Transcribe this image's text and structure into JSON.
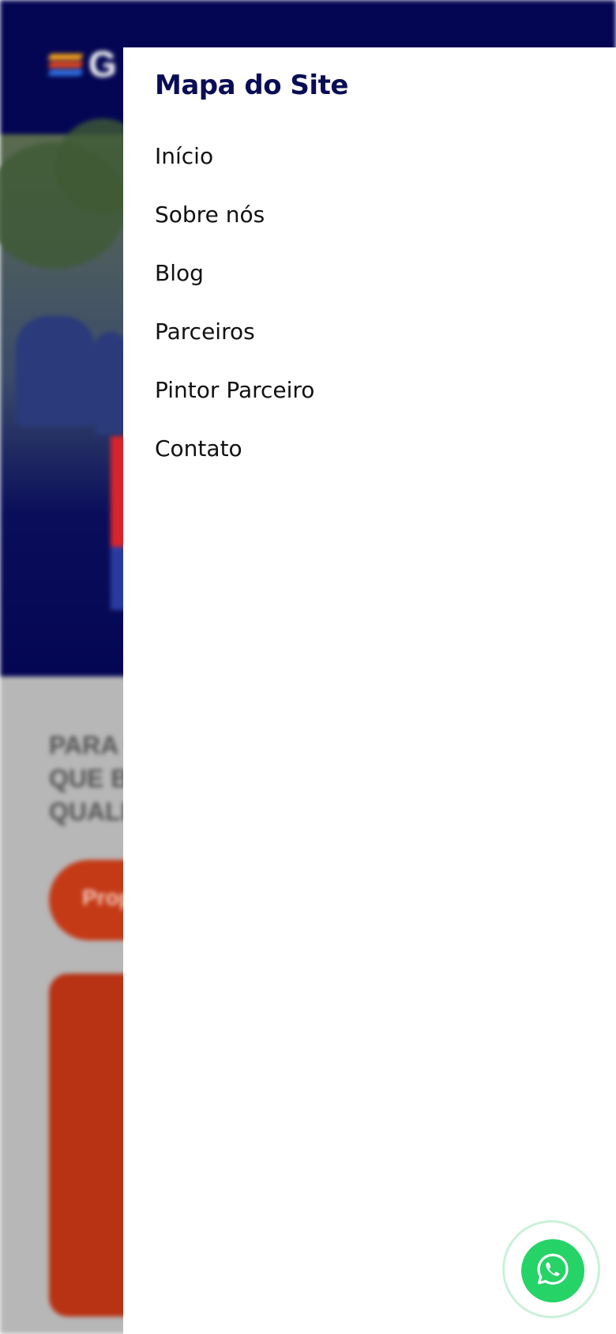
{
  "drawer": {
    "title": "Mapa do Site",
    "items": [
      {
        "label": "Início"
      },
      {
        "label": "Sobre nós"
      },
      {
        "label": "Blog"
      },
      {
        "label": "Parceiros"
      },
      {
        "label": "Pintor Parceiro"
      },
      {
        "label": "Contato"
      }
    ]
  },
  "background": {
    "logo_letter": "G",
    "heading_lines": [
      "PARA O",
      "QUE B",
      "QUALI"
    ],
    "cta_label": "Prop"
  },
  "icons": {
    "whatsapp": "whatsapp-icon",
    "logo": "brand-logo"
  },
  "colors": {
    "header": "#040653",
    "title": "#0a0d55",
    "accent_orange": "#c43a17",
    "whatsapp": "#25d366"
  }
}
